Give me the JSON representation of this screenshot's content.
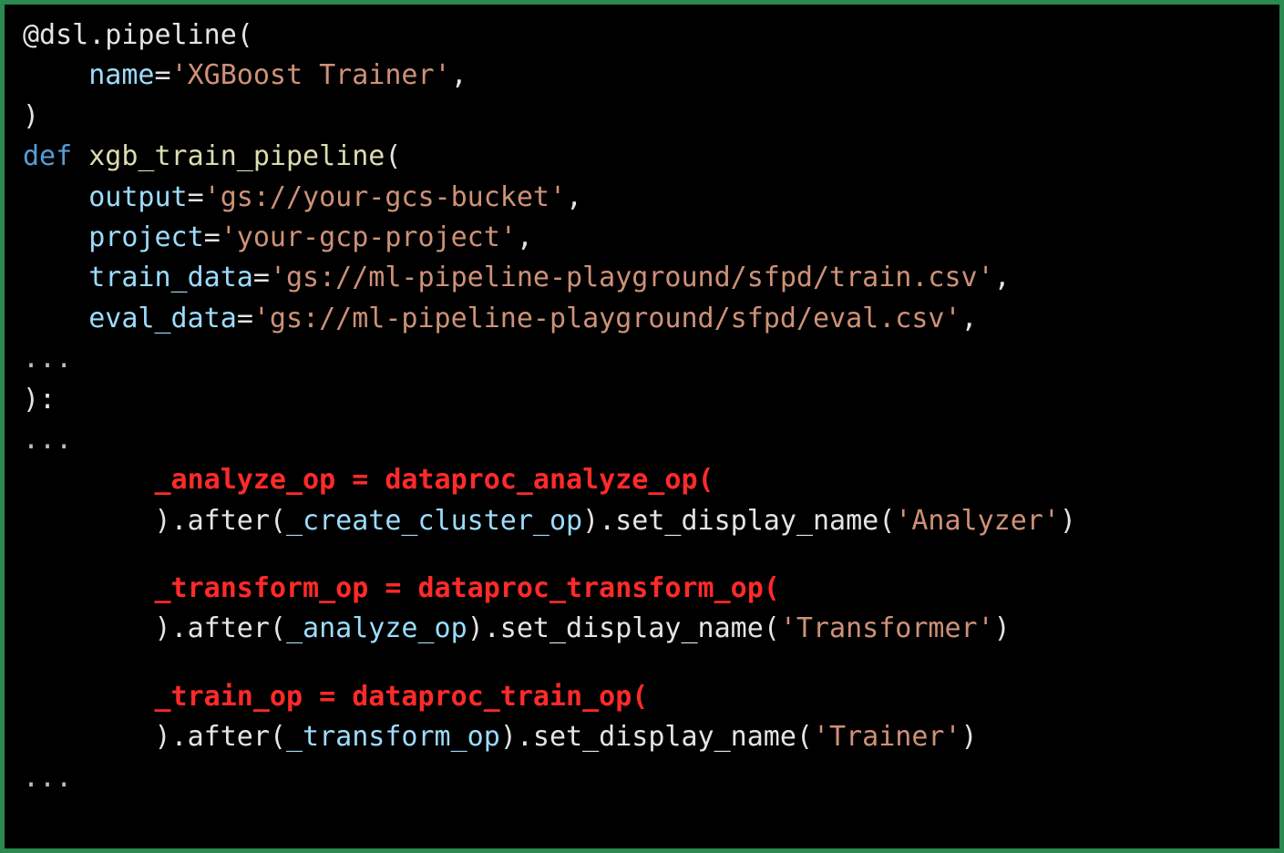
{
  "lines": {
    "l1_decorator": "@dsl.pipeline(",
    "l2_indent": "    ",
    "l2_name": "name",
    "l2_eq": "=",
    "l2_str": "'XGBoost Trainer'",
    "l2_tail": ",",
    "l3_close": ")",
    "l4_def": "def",
    "l4_space": " ",
    "l4_func": "xgb_train_pipeline",
    "l4_open": "(",
    "l5_indent": "    ",
    "l5_name": "output",
    "l5_eq": "=",
    "l5_str": "'gs://your-gcs-bucket'",
    "l5_tail": ",",
    "l6_indent": "    ",
    "l6_name": "project",
    "l6_eq": "=",
    "l6_str": "'your-gcp-project'",
    "l6_tail": ",",
    "l7_indent": "    ",
    "l7_name": "train_data",
    "l7_eq": "=",
    "l7_str": "'gs://ml-pipeline-playground/sfpd/train.csv'",
    "l7_tail": ",",
    "l8_indent": "    ",
    "l8_name": "eval_data",
    "l8_eq": "=",
    "l8_str": "'gs://ml-pipeline-playground/sfpd/eval.csv'",
    "l8_tail": ",",
    "l9_dots": "...",
    "l10_close": "):",
    "l11_dots": "...",
    "l12_indent": "        ",
    "l12_red": "_analyze_op = dataproc_analyze_op(",
    "l13_indent": "        ",
    "l13_a": ").after(",
    "l13_arg": "_create_cluster_op",
    "l13_b": ").set_display_name(",
    "l13_str": "'Analyzer'",
    "l13_c": ")",
    "l14_indent": "        ",
    "l14_red": "_transform_op = dataproc_transform_op(",
    "l15_indent": "        ",
    "l15_a": ").after(",
    "l15_arg": "_analyze_op",
    "l15_b": ").set_display_name(",
    "l15_str": "'Transformer'",
    "l15_c": ")",
    "l16_indent": "        ",
    "l16_red": "_train_op = dataproc_train_op(",
    "l17_indent": "        ",
    "l17_a": ").after(",
    "l17_arg": "_transform_op",
    "l17_b": ").set_display_name(",
    "l17_str": "'Trainer'",
    "l17_c": ")",
    "l18_dots": "..."
  }
}
